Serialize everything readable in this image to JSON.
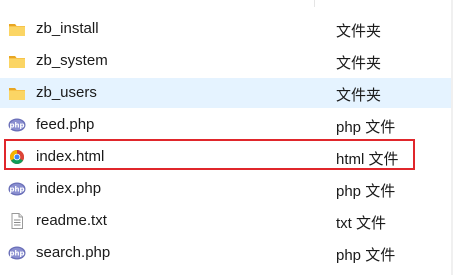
{
  "files": [
    {
      "name": "zb_install",
      "type": "文件夹",
      "icon": "folder-icon"
    },
    {
      "name": "zb_system",
      "type": "文件夹",
      "icon": "folder-icon"
    },
    {
      "name": "zb_users",
      "type": "文件夹",
      "icon": "folder-icon"
    },
    {
      "name": "feed.php",
      "type": "php 文件",
      "icon": "php-file-icon"
    },
    {
      "name": "index.html",
      "type": "html 文件",
      "icon": "chrome-icon"
    },
    {
      "name": "index.php",
      "type": "php 文件",
      "icon": "php-file-icon"
    },
    {
      "name": "readme.txt",
      "type": "txt 文件",
      "icon": "text-file-icon"
    },
    {
      "name": "search.php",
      "type": "php 文件",
      "icon": "php-file-icon"
    }
  ],
  "colors": {
    "highlight_border": "#e0262b",
    "row_selected_bg": "#e5f3ff",
    "folder_yellow": "#f7c34a",
    "php_purple": "#6a6fb8"
  }
}
